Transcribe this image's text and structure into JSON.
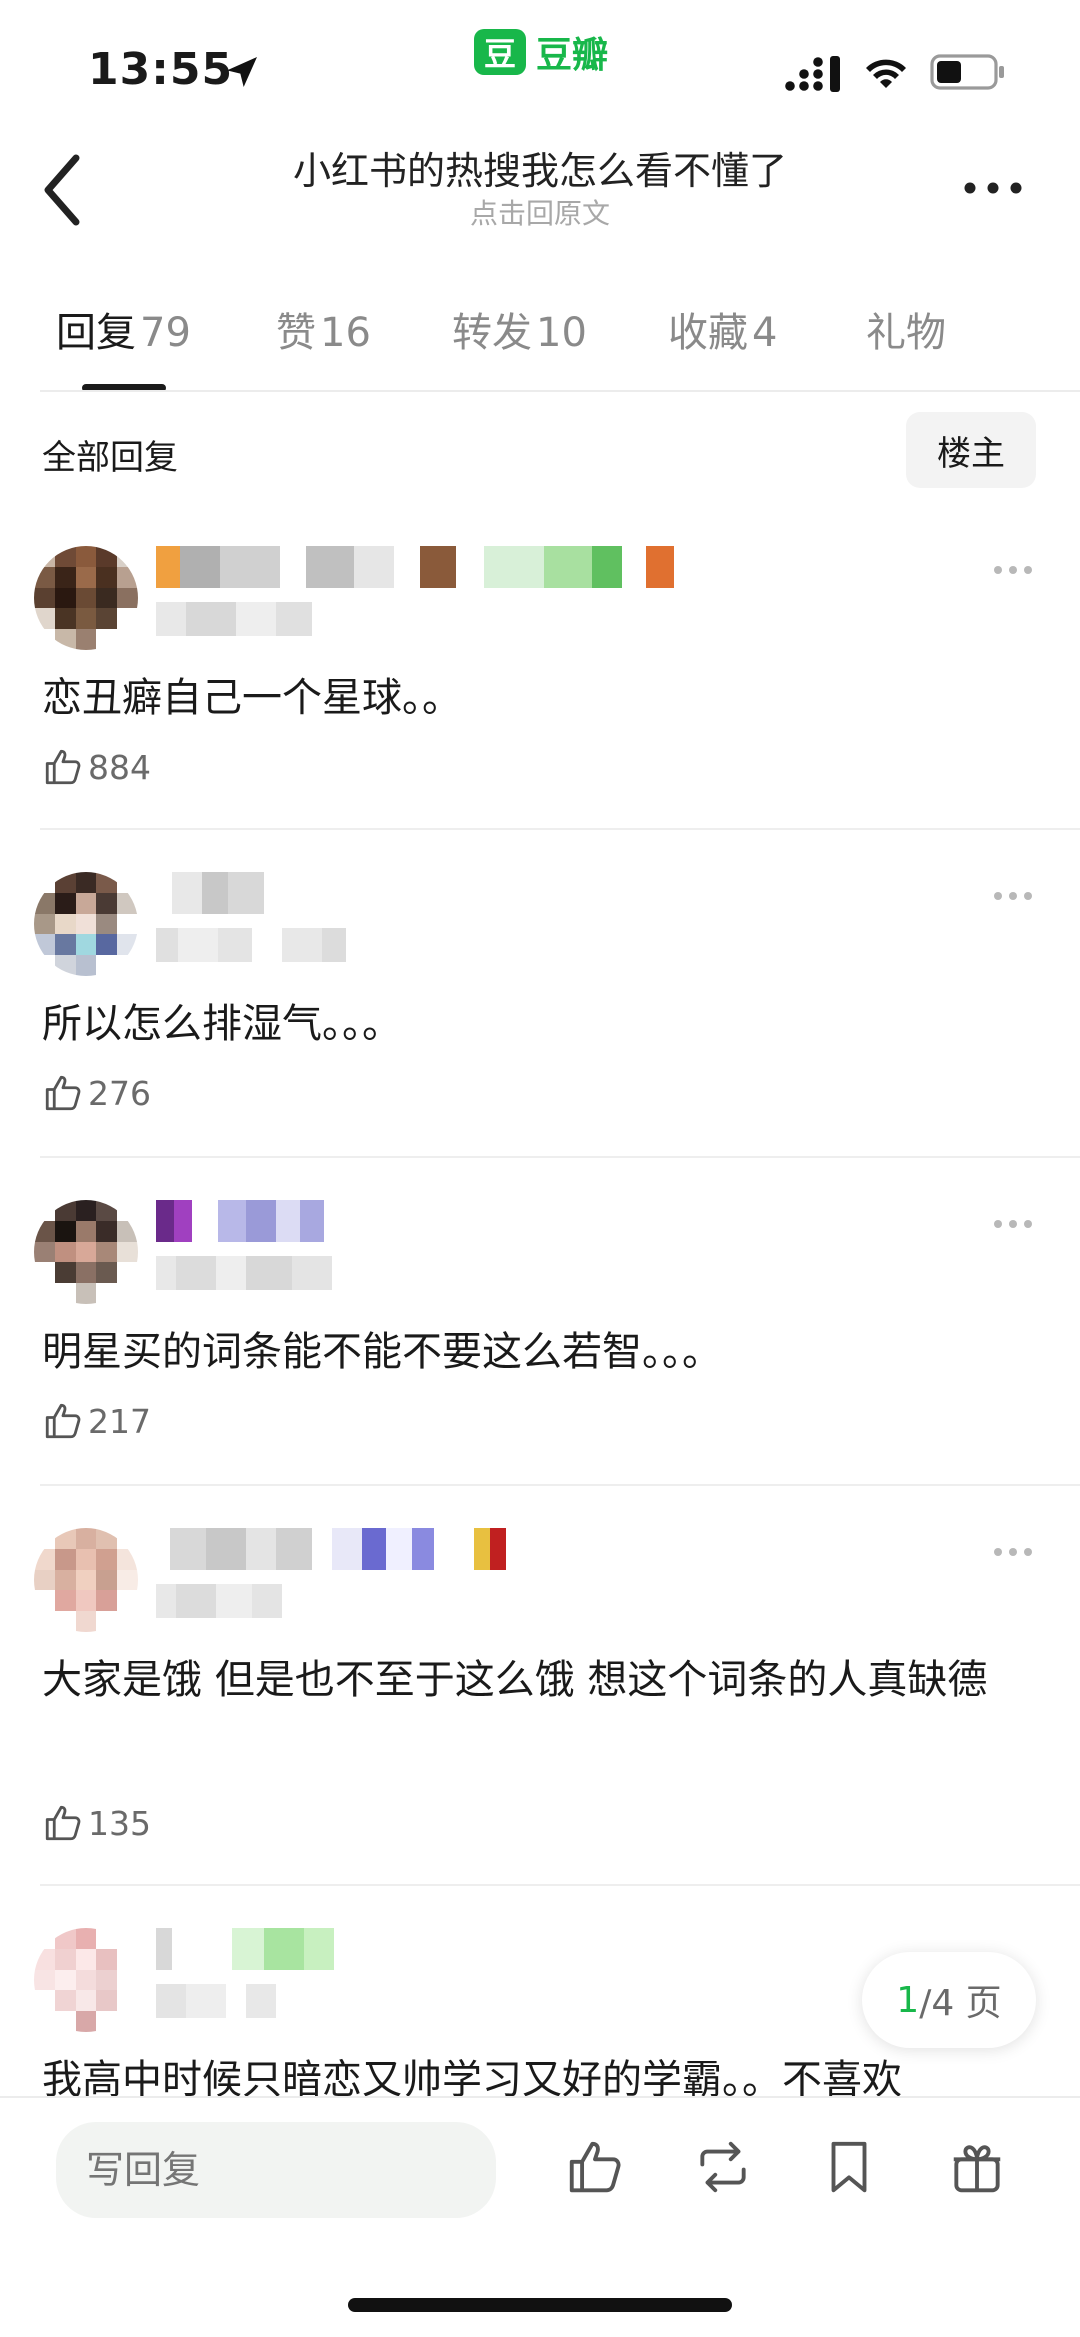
{
  "status_bar": {
    "time": "13:55"
  },
  "app_badge": {
    "logo_glyph": "豆",
    "name": "豆瓣",
    "color": "#18b74a"
  },
  "nav": {
    "title": "小红书的热搜我怎么看不懂了",
    "subtitle": "点击回原文",
    "back_icon": "chevron-left-icon",
    "more_icon": "more-horizontal-icon"
  },
  "tabs": [
    {
      "label": "回复",
      "count": "79",
      "active": true
    },
    {
      "label": "赞",
      "count": "16",
      "active": false
    },
    {
      "label": "转发",
      "count": "10",
      "active": false
    },
    {
      "label": "收藏",
      "count": "4",
      "active": false
    },
    {
      "label": "礼物",
      "count": "",
      "active": false
    }
  ],
  "section": {
    "title": "全部回复",
    "filter_button": "楼主"
  },
  "comments": [
    {
      "text": "恋丑癖自己一个星球。。",
      "likes": "884"
    },
    {
      "text": "所以怎么排湿气。。。",
      "likes": "276"
    },
    {
      "text": "明星买的词条能不能不要这么若智。。。",
      "likes": "217"
    },
    {
      "text": "大家是饿 但是也不至于这么饿 想这个词条的人真缺德",
      "likes": "135"
    },
    {
      "text": "我高中时候只暗恋又帅学习又好的学霸。。不喜欢",
      "likes": ""
    }
  ],
  "pagination": {
    "current": "1",
    "total": "/4 页"
  },
  "bottom_bar": {
    "reply_placeholder": "写回复",
    "icons": [
      "thumbs-up-icon",
      "repost-icon",
      "bookmark-icon",
      "gift-icon"
    ]
  },
  "colors": {
    "accent": "#18b74a",
    "text": "#1a1a1a",
    "muted": "#8a8a8a"
  }
}
